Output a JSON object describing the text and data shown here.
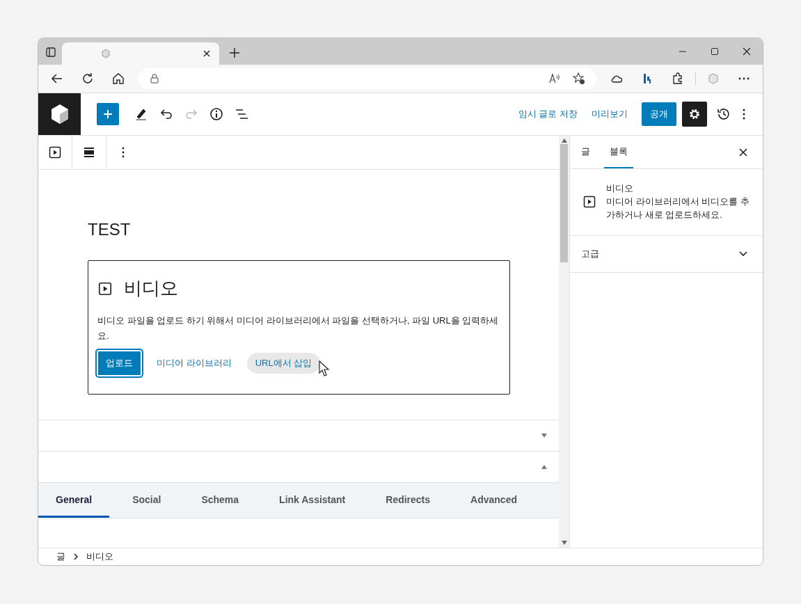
{
  "editor_toolbar": {
    "save_draft": "임시 글로 저장",
    "preview": "미리보기",
    "publish": "공개"
  },
  "content": {
    "title": "TEST",
    "video_block": {
      "label": "비디오",
      "instructions": "비디오 파일을 업로드 하기 위해서 미디어 라이브러리에서 파일을 선택하거나, 파일 URL을 입력하세요.",
      "buttons": [
        {
          "kind": "primary",
          "label": "업로드"
        },
        {
          "kind": "link",
          "label": "미디어 라이브러리"
        },
        {
          "kind": "hover",
          "label": "URL에서 삽입"
        }
      ]
    }
  },
  "metaboxes": [
    {
      "expanded": false
    },
    {
      "expanded": true
    }
  ],
  "seo_tabs": [
    {
      "label": "General",
      "selected": true
    },
    {
      "label": "Social",
      "selected": false
    },
    {
      "label": "Schema",
      "selected": false
    },
    {
      "label": "Link Assistant",
      "selected": false
    },
    {
      "label": "Redirects",
      "selected": false
    },
    {
      "label": "Advanced",
      "selected": false
    }
  ],
  "breadcrumb": [
    "글",
    "비디오"
  ],
  "sidebar": {
    "tabs": [
      {
        "label": "글",
        "selected": false
      },
      {
        "label": "블록",
        "selected": true
      }
    ],
    "block_card": {
      "title": "비디오",
      "description": "미디어 라이브러리에서 비디오를 추가하거나 새로 업로드하세요."
    },
    "panels": [
      {
        "label": "고급",
        "expanded": false
      }
    ]
  }
}
